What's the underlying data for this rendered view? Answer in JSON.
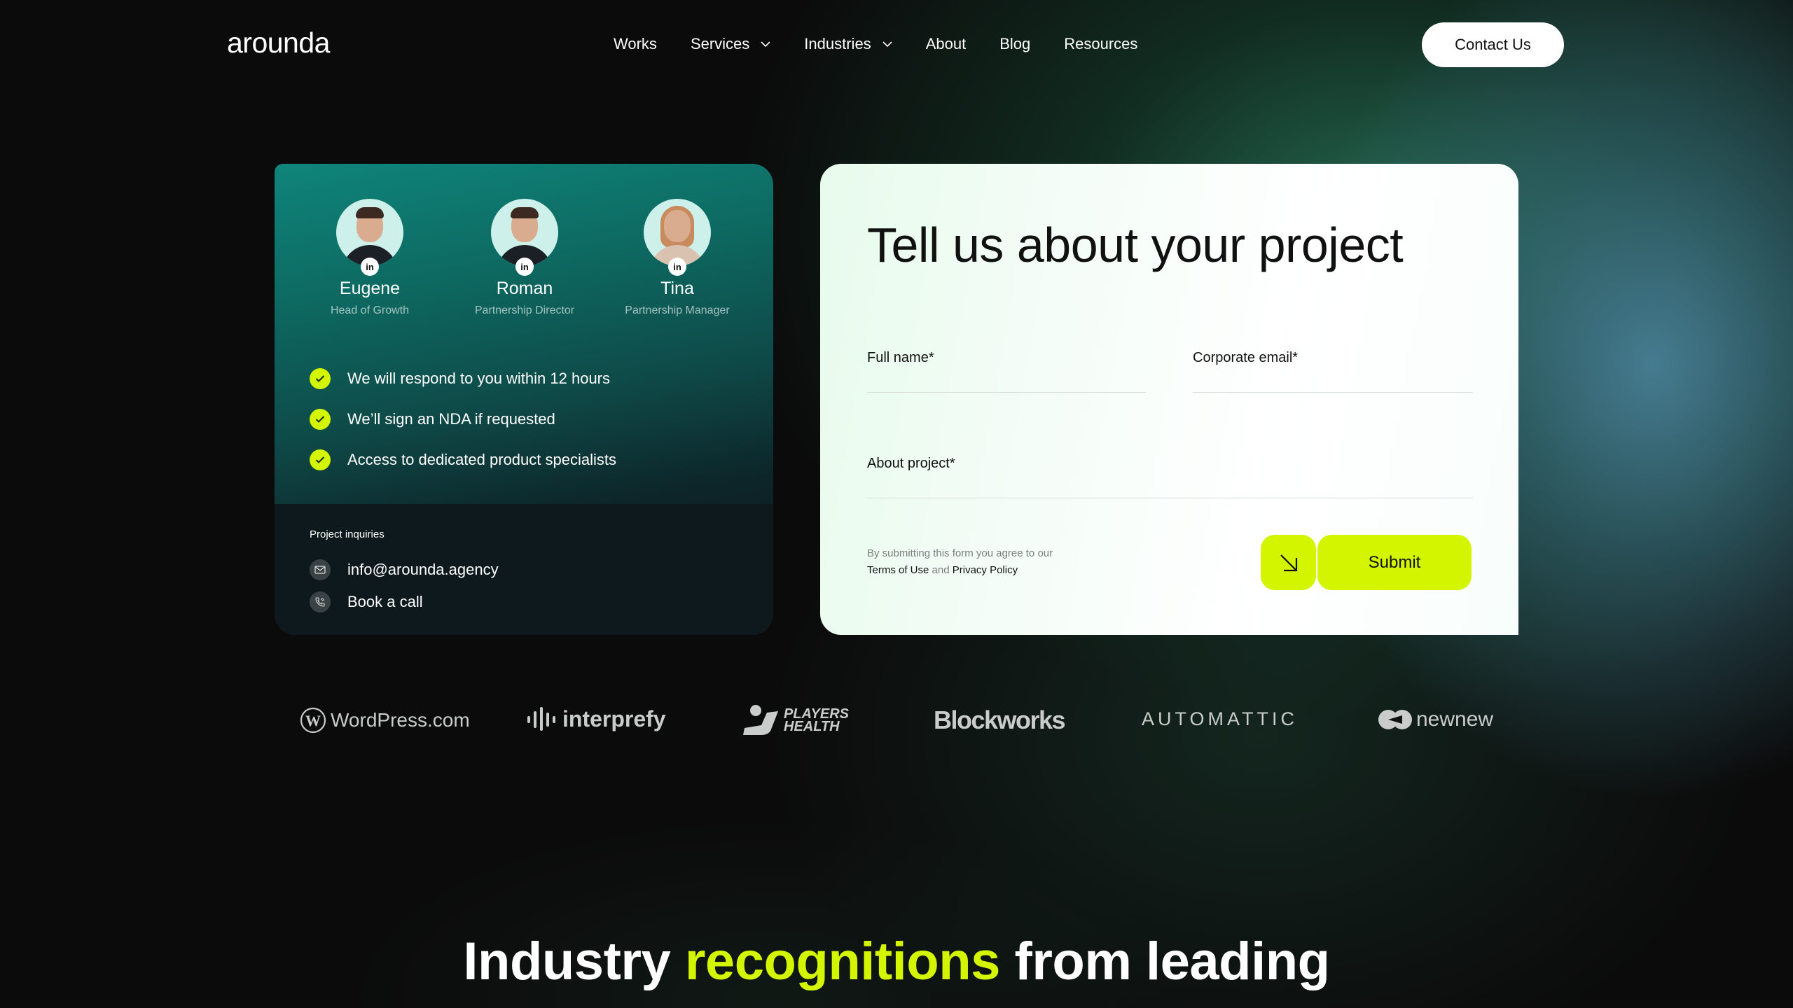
{
  "nav": {
    "logo": "arounda",
    "items": [
      {
        "label": "Works",
        "has_dropdown": false
      },
      {
        "label": "Services",
        "has_dropdown": true
      },
      {
        "label": "Industries",
        "has_dropdown": true
      },
      {
        "label": "About",
        "has_dropdown": false
      },
      {
        "label": "Blog",
        "has_dropdown": false
      },
      {
        "label": "Resources",
        "has_dropdown": false
      }
    ],
    "cta": "Contact Us"
  },
  "team_card": {
    "people": [
      {
        "name": "Eugene",
        "role": "Head of Growth",
        "badge": "in"
      },
      {
        "name": "Roman",
        "role": "Partnership Director",
        "badge": "in"
      },
      {
        "name": "Tina",
        "role": "Partnership Manager",
        "badge": "in"
      }
    ],
    "benefits": [
      "We will respond to you within 12 hours",
      "We’ll sign an NDA if requested",
      "Access to dedicated product specialists"
    ],
    "inquiries_title": "Project inquiries",
    "email": "info@arounda.agency",
    "call": "Book a call"
  },
  "form": {
    "title": "Tell us about your project",
    "full_name_label": "Full name*",
    "full_name_value": "",
    "email_label": "Corporate email*",
    "email_value": "",
    "about_label": "About project*",
    "about_value": "",
    "disclaimer_prefix": "By submitting this form you agree to our",
    "terms": "Terms of Use",
    "and": "and",
    "privacy": "Privacy Policy",
    "submit": "Submit"
  },
  "logos": [
    "WordPress.com",
    "interprefy",
    "PLAYERS HEALTH",
    "Blockworks",
    "AUTOMATTIC",
    "newnew"
  ],
  "headline": {
    "part1": "Industry",
    "accent": "recognitions",
    "part2": "from leading"
  },
  "colors": {
    "accent": "#d4f500",
    "background": "#0b0b0b",
    "team_card_top": "#0f857a",
    "form_bg": "#f5fdf8"
  }
}
